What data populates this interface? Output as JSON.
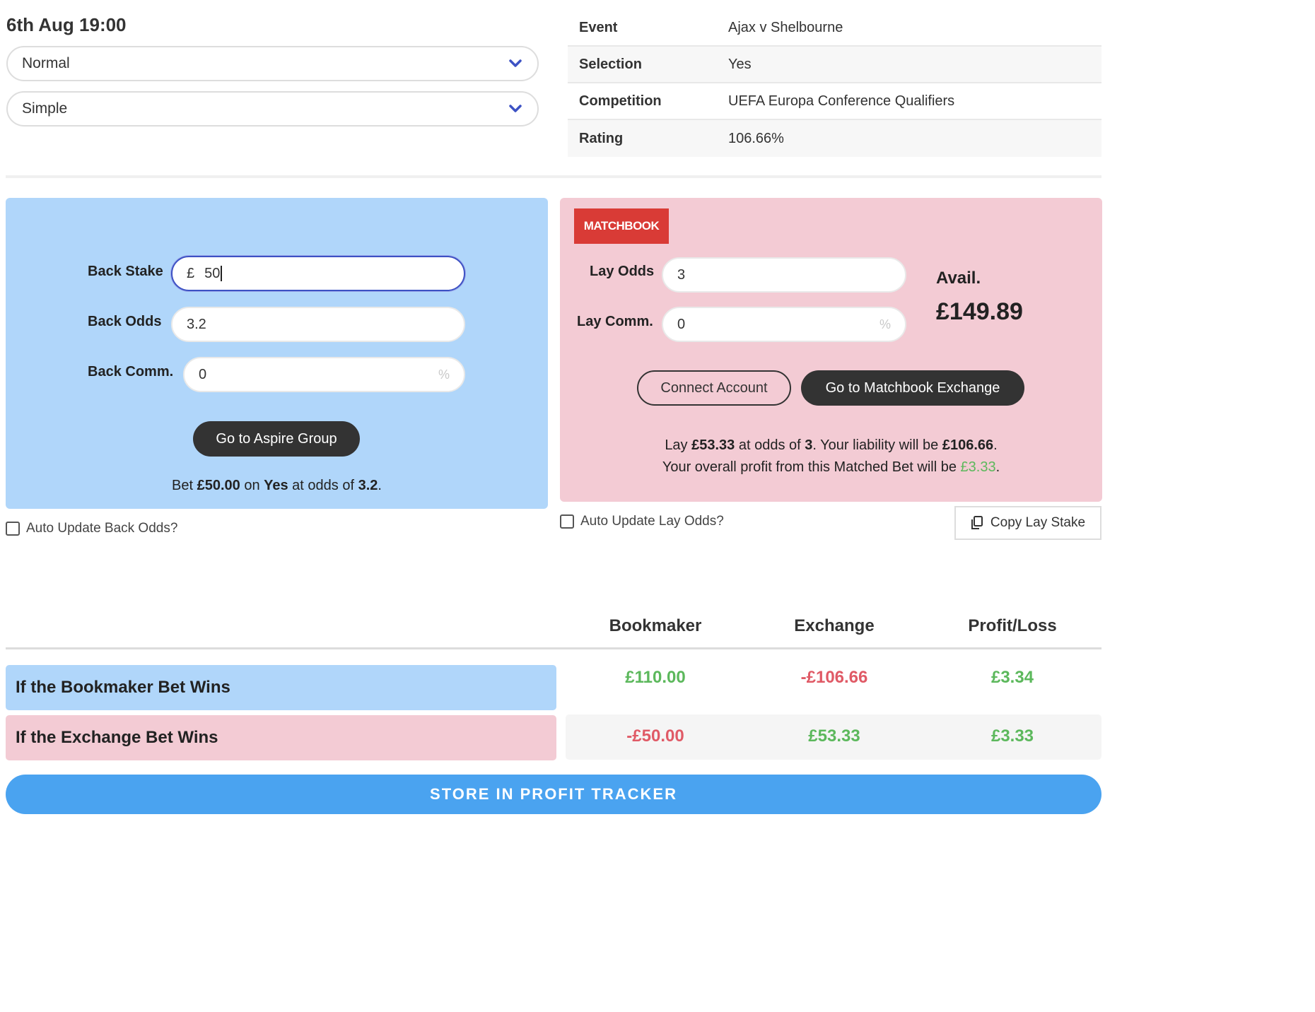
{
  "header": {
    "datetime": "6th Aug 19:00",
    "mode_select": "Normal",
    "type_select": "Simple"
  },
  "info": {
    "event_label": "Event",
    "event_value": "Ajax v Shelbourne",
    "selection_label": "Selection",
    "selection_value": "Yes",
    "competition_label": "Competition",
    "competition_value": "UEFA Europa Conference Qualifiers",
    "rating_label": "Rating",
    "rating_value": "106.66%"
  },
  "back": {
    "stake_label": "Back Stake",
    "stake_currency": "£",
    "stake_value": "50",
    "odds_label": "Back Odds",
    "odds_value": "3.2",
    "comm_label": "Back Comm.",
    "comm_value": "0",
    "comm_unit": "%",
    "go_button": "Go to Aspire Group",
    "summary": {
      "p1": "Bet ",
      "stake": "£50.00",
      "p2": " on ",
      "sel": "Yes",
      "p3": " at odds of ",
      "odds": "3.2",
      "p4": "."
    },
    "auto_update_label": "Auto Update Back Odds?"
  },
  "lay": {
    "logo_text": "MATCHBOOK",
    "odds_label": "Lay Odds",
    "odds_value": "3",
    "comm_label": "Lay Comm.",
    "comm_value": "0",
    "comm_unit": "%",
    "avail_label": "Avail.",
    "avail_value": "£149.89",
    "connect_button": "Connect Account",
    "go_button": "Go to Matchbook Exchange",
    "summary": {
      "p1": "Lay ",
      "stake": "£53.33",
      "p2": " at odds of ",
      "odds": "3",
      "p3": ". Your liability will be ",
      "liability": "£106.66",
      "p4": ".",
      "p5": "Your overall profit from this Matched Bet will be ",
      "profit": "£3.33",
      "p6": "."
    },
    "auto_update_label": "Auto Update Lay Odds?",
    "copy_button": "Copy Lay Stake"
  },
  "results": {
    "headers": [
      "Bookmaker",
      "Exchange",
      "Profit/Loss"
    ],
    "rows": [
      {
        "label": "If the Bookmaker Bet Wins",
        "bookmaker": "£110.00",
        "exchange": "-£106.66",
        "profit": "£3.34"
      },
      {
        "label": "If the Exchange Bet Wins",
        "bookmaker": "-£50.00",
        "exchange": "£53.33",
        "profit": "£3.33"
      }
    ]
  },
  "store_button": "STORE IN PROFIT TRACKER",
  "colors": {
    "back_panel": "#b0d6fa",
    "lay_panel": "#f3cbd4",
    "positive": "#5cb85c",
    "negative": "#e05a66",
    "store_button": "#4aa3f0",
    "logo": "#d93b36"
  }
}
